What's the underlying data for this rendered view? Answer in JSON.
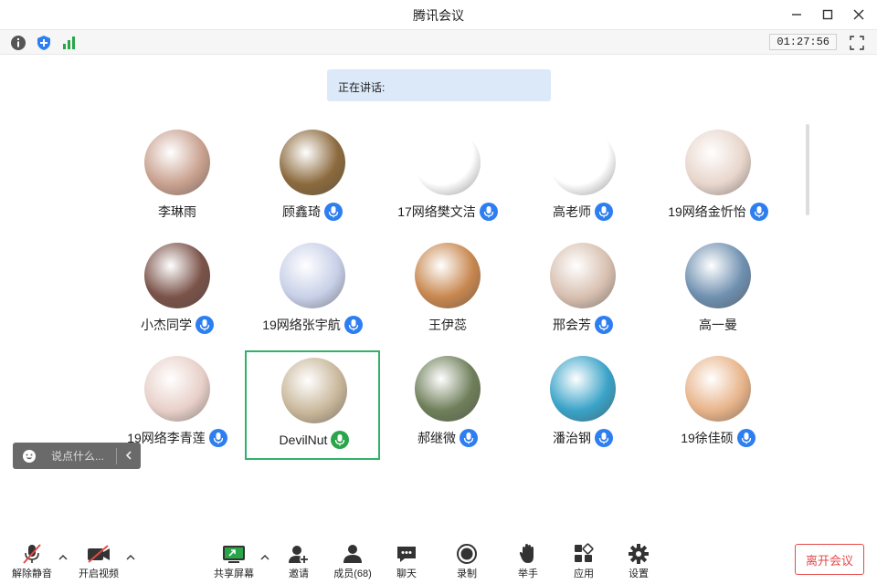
{
  "window": {
    "title": "腾讯会议"
  },
  "toolbar": {
    "timer": "01:27:56"
  },
  "speaking": {
    "label": "正在讲话:"
  },
  "participants": [
    {
      "name": "李琳雨",
      "mic": false,
      "active": false,
      "avatar_color": "#c9a18f"
    },
    {
      "name": "顾鑫琦",
      "mic": true,
      "active": false,
      "avatar_color": "#8c6a3d"
    },
    {
      "name": "17网络樊文洁",
      "mic": true,
      "active": false,
      "avatar_color": "#ffffff"
    },
    {
      "name": "高老师",
      "mic": true,
      "active": false,
      "avatar_color": "#ffffff"
    },
    {
      "name": "19网络金忻怡",
      "mic": true,
      "active": false,
      "avatar_color": "#e8d6cc"
    },
    {
      "name": "小杰同学",
      "mic": true,
      "active": false,
      "avatar_color": "#7a5248"
    },
    {
      "name": "19网络张宇航",
      "mic": true,
      "active": false,
      "avatar_color": "#c8d0e8"
    },
    {
      "name": "王伊蕊",
      "mic": false,
      "active": false,
      "avatar_color": "#c8874f"
    },
    {
      "name": "邢会芳",
      "mic": true,
      "active": false,
      "avatar_color": "#d8c0b0"
    },
    {
      "name": "高一曼",
      "mic": false,
      "active": false,
      "avatar_color": "#6f90b0"
    },
    {
      "name": "19网络李青莲",
      "mic": true,
      "active": false,
      "avatar_color": "#e8d0c8"
    },
    {
      "name": "DevilNut",
      "mic": true,
      "active": true,
      "avatar_color": "#c9b79a"
    },
    {
      "name": "郝继微",
      "mic": true,
      "active": false,
      "avatar_color": "#6f7f5a"
    },
    {
      "name": "潘治钢",
      "mic": true,
      "active": false,
      "avatar_color": "#3aa3c8"
    },
    {
      "name": "19徐佳硕",
      "mic": true,
      "active": false,
      "avatar_color": "#e8b48a"
    }
  ],
  "chat": {
    "placeholder": "说点什么..."
  },
  "bottom": {
    "unmute": "解除静音",
    "video": "开启视频",
    "share": "共享屏幕",
    "invite": "邀请",
    "members": "成员(68)",
    "chat": "聊天",
    "record": "录制",
    "raise": "举手",
    "apps": "应用",
    "settings": "设置",
    "leave": "离开会议"
  },
  "colors": {
    "accent": "#2d7ef0",
    "active_border": "#31b26a",
    "leave": "#e44a4a",
    "speaking_bg": "#dbe9f8"
  }
}
